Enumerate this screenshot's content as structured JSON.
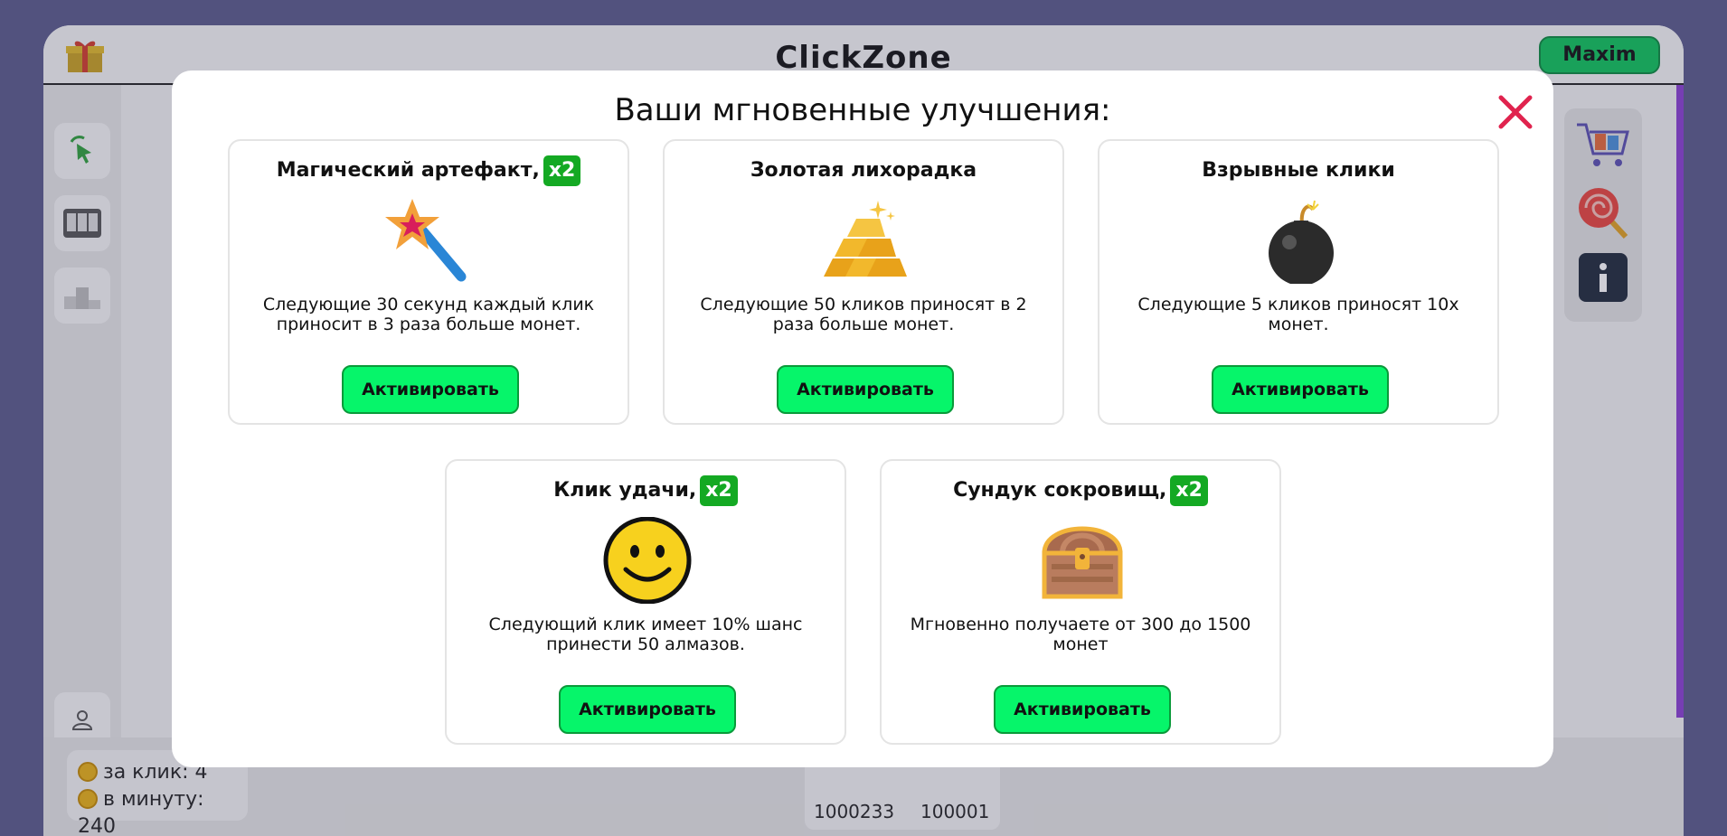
{
  "app": {
    "brand": "ClickZone",
    "user_name": "Maxim",
    "stats": {
      "per_click": "за клик: 4",
      "per_minute": "в минуту: 240"
    },
    "balance": {
      "coins": "1000233",
      "diamonds": "100001"
    }
  },
  "modal": {
    "title": "Ваши мгновенные улучшения:",
    "cards": [
      {
        "title": "Магический артефакт,",
        "badge": "x2",
        "icon": "magic-wand-icon",
        "description": "Следующие 30 секунд каждый клик приносит в 3 раза больше монет.",
        "button": "Активировать"
      },
      {
        "title": "Золотая лихорадка",
        "badge": "",
        "icon": "gold-bars-icon",
        "description": "Следующие 50 кликов приносят в 2 раза больше монет.",
        "button": "Активировать"
      },
      {
        "title": "Взрывные клики",
        "badge": "",
        "icon": "bomb-icon",
        "description": "Следующие 5 кликов приносят 10x монет.",
        "button": "Активировать"
      },
      {
        "title": "Клик удачи,",
        "badge": "x2",
        "icon": "smiley-icon",
        "description": "Следующий клик имеет 10% шанс принести 50 алмазов.",
        "button": "Активировать"
      },
      {
        "title": "Сундук сокровищ,",
        "badge": "x2",
        "icon": "treasure-chest-icon",
        "description": "Мгновенно получаете от 300 до 1500 монет",
        "button": "Активировать"
      }
    ]
  },
  "colors": {
    "accent_green": "#06f56a",
    "badge_green": "#14a923",
    "close_red": "#e0234e",
    "backdrop": "#5a5a8a"
  }
}
